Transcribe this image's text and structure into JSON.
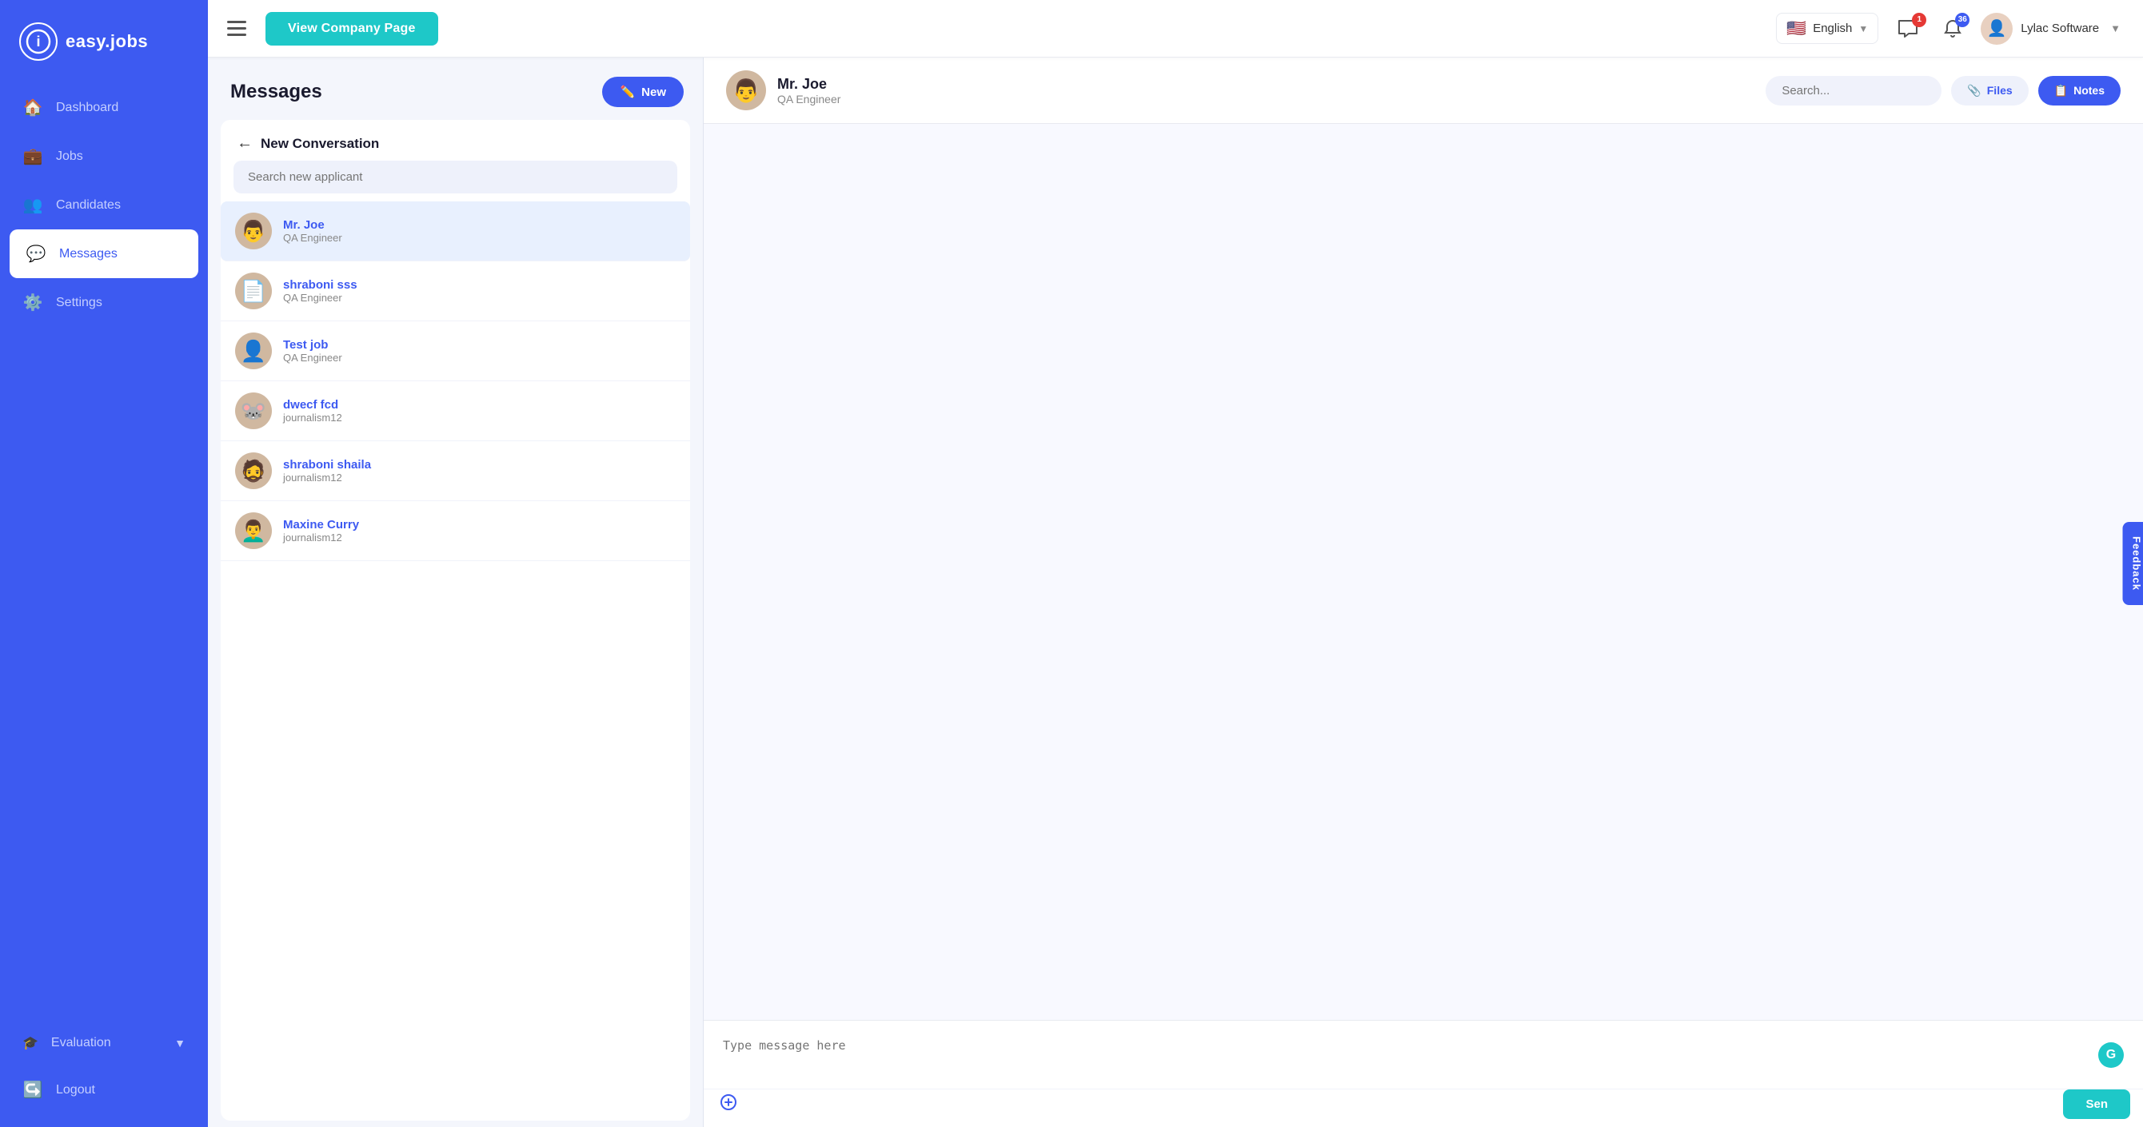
{
  "sidebar": {
    "logo_icon": "i",
    "logo_text": "easy.jobs",
    "items": [
      {
        "id": "dashboard",
        "label": "Dashboard",
        "icon": "🏠"
      },
      {
        "id": "jobs",
        "label": "Jobs",
        "icon": "💼"
      },
      {
        "id": "candidates",
        "label": "Candidates",
        "icon": "👥"
      },
      {
        "id": "messages",
        "label": "Messages",
        "icon": "💬",
        "active": true
      },
      {
        "id": "settings",
        "label": "Settings",
        "icon": "⚙️"
      },
      {
        "id": "evaluation",
        "label": "Evaluation",
        "icon": "🎓"
      }
    ],
    "logout_label": "Logout",
    "logout_icon": "➡️"
  },
  "topbar": {
    "view_company_page_label": "View Company Page",
    "lang_label": "English",
    "flag": "🇺🇸",
    "chat_badge": "1",
    "bell_badge": "36",
    "company_name": "Lylac Software"
  },
  "messages": {
    "title": "Messages",
    "new_btn_label": "New",
    "new_conv_title": "New Conversation",
    "search_placeholder": "Search new applicant",
    "conversations": [
      {
        "id": "mr-joe",
        "name": "Mr. Joe",
        "role": "QA Engineer",
        "avatar": "👨",
        "selected": true
      },
      {
        "id": "shraboni-sss",
        "name": "shraboni sss",
        "role": "QA Engineer",
        "avatar": "📄",
        "selected": false
      },
      {
        "id": "test-job",
        "name": "Test job",
        "role": "QA Engineer",
        "avatar": "👤",
        "selected": false
      },
      {
        "id": "dwecf-fcd",
        "name": "dwecf fcd",
        "role": "journalism12",
        "avatar": "🐭",
        "selected": false
      },
      {
        "id": "shraboni-shaila",
        "name": "shraboni shaila",
        "role": "journalism12",
        "avatar": "🧔",
        "selected": false
      },
      {
        "id": "maxine-curry",
        "name": "Maxine Curry",
        "role": "journalism12",
        "avatar": "👨‍🦱",
        "selected": false
      }
    ]
  },
  "chat": {
    "user_name": "Mr. Joe",
    "user_role": "QA Engineer",
    "search_placeholder": "Search...",
    "files_label": "Files",
    "notes_label": "Notes",
    "message_placeholder": "Type message here",
    "send_label": "Sen"
  },
  "feedback": {
    "label": "Feedback"
  }
}
